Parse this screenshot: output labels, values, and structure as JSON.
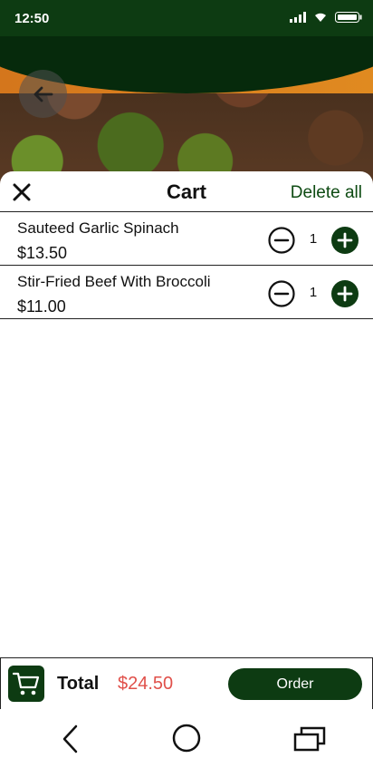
{
  "status_bar": {
    "time": "12:50"
  },
  "cart": {
    "title": "Cart",
    "delete_all": "Delete all",
    "items": [
      {
        "name": "Sauteed Garlic Spinach",
        "price": "$13.50",
        "qty": "1"
      },
      {
        "name": "Stir-Fried Beef With Broccoli",
        "price": "$11.00",
        "qty": "1"
      }
    ]
  },
  "footer": {
    "total_label": "Total",
    "total_value": "$24.50",
    "order_label": "Order"
  },
  "colors": {
    "brand_green": "#0d3b12",
    "accent_red": "#e0504a"
  },
  "icons": [
    "back-arrow-icon",
    "close-icon",
    "minus-circle-icon",
    "plus-circle-icon",
    "cart-icon",
    "nav-back-icon",
    "nav-home-icon",
    "nav-recent-icon",
    "signal-icon",
    "wifi-icon",
    "battery-icon"
  ]
}
